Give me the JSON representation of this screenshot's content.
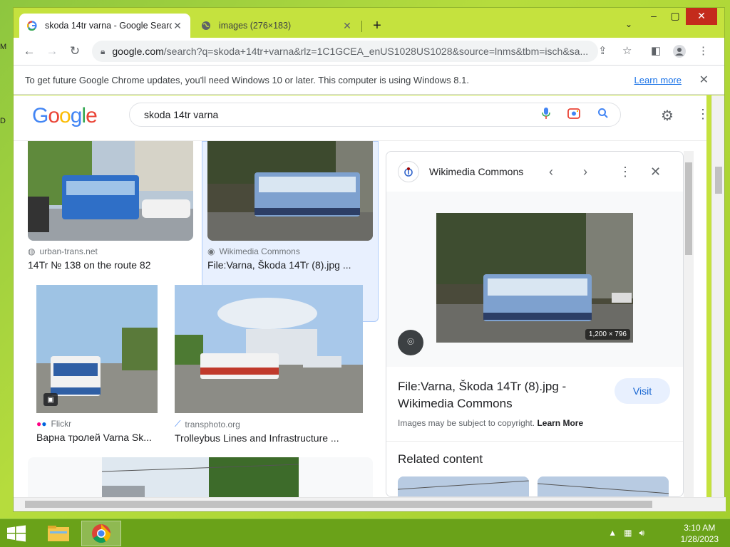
{
  "desktop": {
    "left_letters": [
      "M",
      "D"
    ]
  },
  "browser": {
    "tabs": [
      {
        "title": "skoda 14tr varna - Google Search",
        "icon": "google-g-icon",
        "active": true
      },
      {
        "title": "images (276×183)",
        "icon": "globe-icon",
        "active": false
      }
    ],
    "new_tab": "+",
    "tab_search": "⌄",
    "window_controls": {
      "minimize": "–",
      "restore": "▢",
      "close": "✕"
    },
    "url_host": "google.com",
    "url_rest": "/search?q=skoda+14tr+varna&rlz=1C1GCEA_enUS1028US1028&source=lnms&tbm=isch&sa...",
    "infobar": {
      "message": "To get future Google Chrome updates, you'll need Windows 10 or later. This computer is using Windows 8.1.",
      "link": "Learn more"
    }
  },
  "google": {
    "logo": [
      "G",
      "o",
      "o",
      "g",
      "l",
      "e"
    ],
    "logo_colors": [
      "#4285F4",
      "#EA4335",
      "#FBBC05",
      "#4285F4",
      "#34A853",
      "#EA4335"
    ],
    "query": "skoda 14tr varna"
  },
  "results": [
    {
      "source": "urban-trans.net",
      "caption": "14Tr № 138 on the route 82"
    },
    {
      "source": "Wikimedia Commons",
      "caption": "File:Varna, Škoda 14Tr (8).jpg ..."
    },
    {
      "source": "Flickr",
      "caption": "Варна тролей Varna Sk..."
    },
    {
      "source": "transphoto.org",
      "caption": "Trolleybus Lines and Infrastructure ..."
    }
  ],
  "panel": {
    "site": "Wikimedia Commons",
    "image_dims": "1,200 × 796",
    "title": "File:Varna, Škoda 14Tr (8).jpg - Wikimedia Commons",
    "visit": "Visit",
    "copyright_text": "Images may be subject to copyright.",
    "copyright_link": "Learn More",
    "related": "Related content"
  },
  "taskbar": {
    "time": "3:10 AM",
    "date": "1/28/2023"
  },
  "colors": {
    "desktop": "#8dc63f",
    "accent_blue": "#1a73e8",
    "selected_bg": "#e8f0fe"
  }
}
